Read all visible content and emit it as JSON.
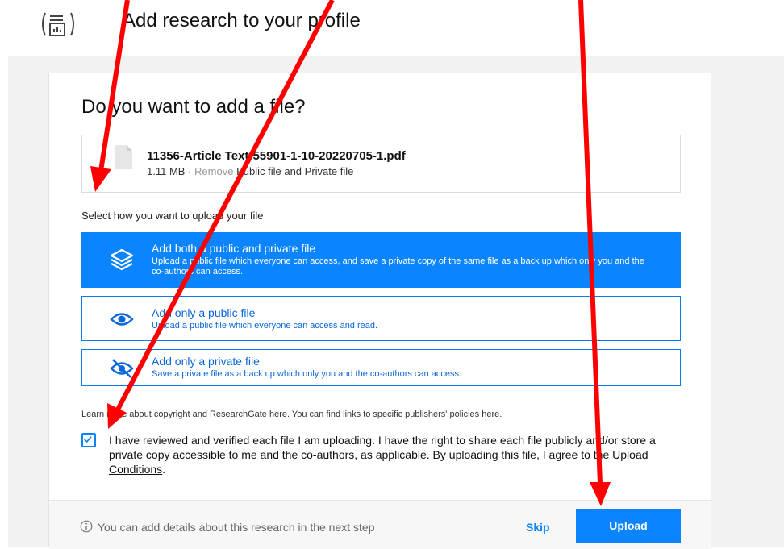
{
  "header": {
    "title": "Add research to your profile",
    "logo_icon": "research-logo-icon"
  },
  "dialog": {
    "heading": "Do you want to add a file?",
    "file": {
      "name": "11356-Article Text-55901-1-10-20220705-1.pdf",
      "size": "1.11 MB",
      "separator": "·",
      "remove_label": "Remove",
      "file_type": "Public file and Private file"
    },
    "select_label": "Select how you want to upload your file",
    "options": [
      {
        "title": "Add both a public and private file",
        "description": "Upload a public file which everyone can access, and save a private copy of the same file as a back up which only you and the co-authors can access.",
        "icon": "layers-icon",
        "selected": true
      },
      {
        "title": "Add only a public file",
        "description": "Upload a public file which everyone can access and read.",
        "icon": "eye-icon",
        "selected": false
      },
      {
        "title": "Add only a private file",
        "description": "Save a private file as a back up which only you and the co-authors can access.",
        "icon": "eye-off-icon",
        "selected": false
      }
    ],
    "learn_more": {
      "text1": "Learn more about copyright and ResearchGate ",
      "link1": "here",
      "text2": ". You can find links to specific publishers' policies ",
      "link2": "here",
      "text3": "."
    },
    "consent": {
      "checked": true,
      "text": "I have reviewed and verified each file I am uploading. I have the right to share each file publicly and/or store a private copy accessible to me and the co-authors, as applicable. By uploading this file, I agree to the ",
      "link": "Upload Conditions",
      "end": "."
    },
    "footer": {
      "info_text": "You can add details about this research in the next step",
      "skip_label": "Skip",
      "upload_label": "Upload"
    }
  },
  "colors": {
    "accent": "#0a84ff",
    "annotation_arrow": "#ff0000"
  }
}
